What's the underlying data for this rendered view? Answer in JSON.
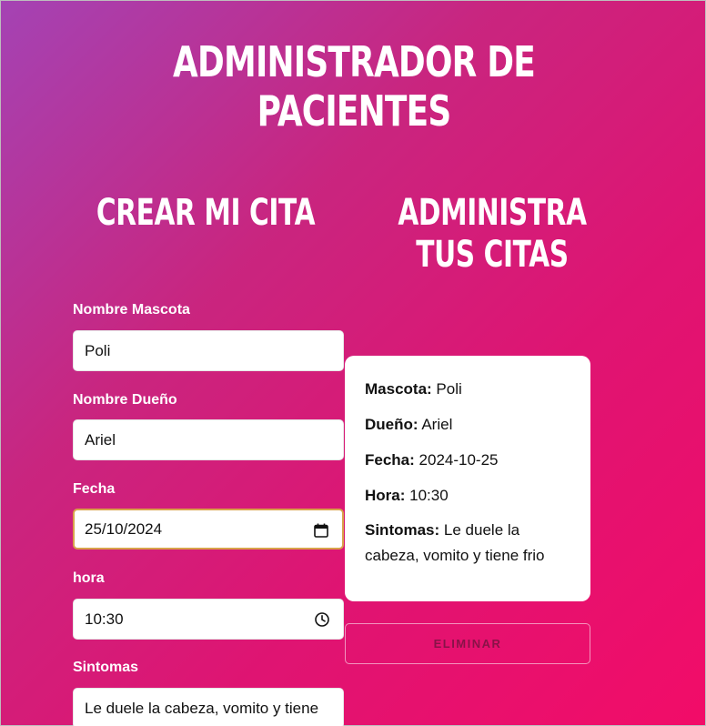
{
  "app": {
    "title": "ADMINISTRADOR DE PACIENTES"
  },
  "form": {
    "title": "CREAR MI CITA",
    "fields": {
      "mascota": {
        "label": "Nombre Mascota",
        "value": "Poli"
      },
      "dueno": {
        "label": "Nombre Dueño",
        "value": "Ariel"
      },
      "fecha": {
        "label": "Fecha",
        "value": "25/10/2024",
        "icon": "calendar-icon"
      },
      "hora": {
        "label": "hora",
        "value": "10:30",
        "icon": "clock-icon"
      },
      "sintomas": {
        "label": "Sintomas",
        "value": "Le duele la cabeza, vomito y tiene"
      }
    }
  },
  "list": {
    "title": "ADMINISTRA TUS CITAS",
    "appointment": {
      "mascota": {
        "key": "Mascota:",
        "value": "Poli"
      },
      "dueno": {
        "key": "Dueño:",
        "value": "Ariel"
      },
      "fecha": {
        "key": "Fecha:",
        "value": "2024-10-25"
      },
      "hora": {
        "key": "Hora:",
        "value": "10:30"
      },
      "sintomas": {
        "key": "Sintomas:",
        "value": "Le duele la cabeza, vomito y tiene frio"
      }
    },
    "delete_label": "ELIMINAR"
  },
  "colors": {
    "gradient_start": "#a443b4",
    "gradient_end": "#f20c68",
    "focus_border": "#d8a24a"
  }
}
